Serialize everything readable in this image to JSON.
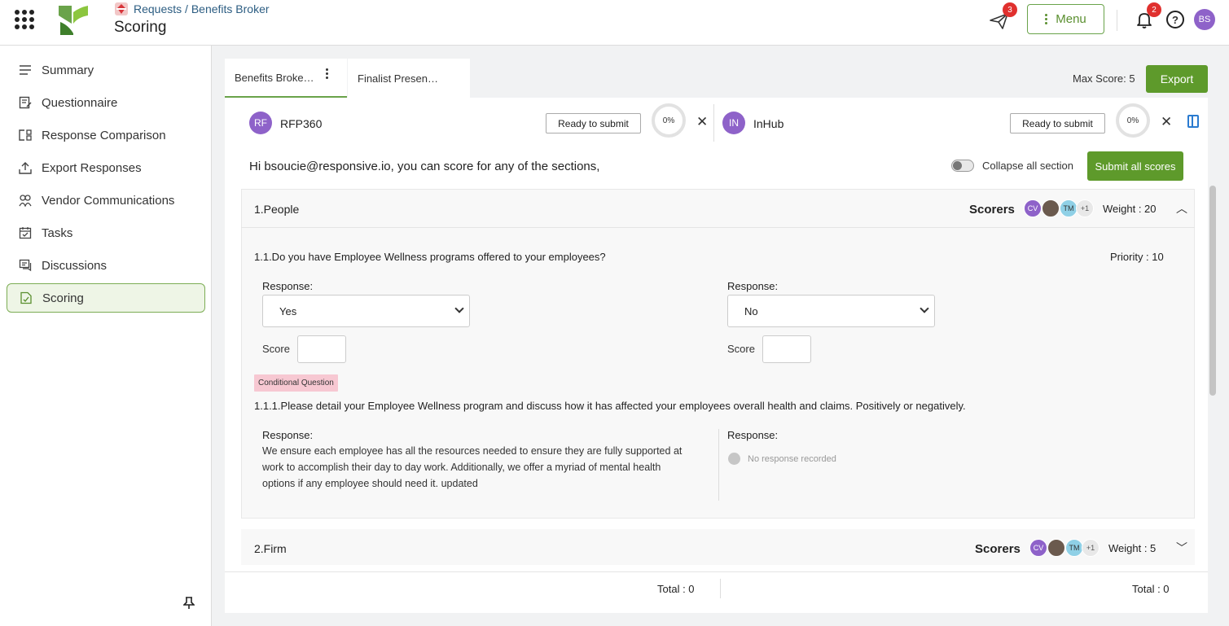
{
  "header": {
    "breadcrumb": "Requests / Benefits Broker",
    "title": "Scoring",
    "send_badge": "3",
    "menu_label": "Menu",
    "bell_badge": "2",
    "help_label": "?",
    "user_initials": "BS"
  },
  "sidebar": {
    "items": [
      {
        "label": "Summary",
        "icon": "list-icon"
      },
      {
        "label": "Questionnaire",
        "icon": "questionnaire-icon"
      },
      {
        "label": "Response Comparison",
        "icon": "compare-icon"
      },
      {
        "label": "Export Responses",
        "icon": "upload-icon"
      },
      {
        "label": "Vendor Communications",
        "icon": "users-icon"
      },
      {
        "label": "Tasks",
        "icon": "calendar-check-icon"
      },
      {
        "label": "Discussions",
        "icon": "chat-icon"
      },
      {
        "label": "Scoring",
        "icon": "scoring-icon",
        "active": true
      }
    ]
  },
  "tabs": [
    "Benefits Broke…",
    "Finalist Presen…"
  ],
  "toolbar": {
    "max_score": "Max Score: 5",
    "export_label": "Export"
  },
  "vendors": [
    {
      "initials": "RF",
      "name": "RFP360",
      "ready_label": "Ready to submit",
      "progress": "0%"
    },
    {
      "initials": "IN",
      "name": "InHub",
      "ready_label": "Ready to submit",
      "progress": "0%"
    }
  ],
  "greeting": "Hi bsoucie@responsive.io, you can score for any of the sections,",
  "collapse_label": "Collapse all section",
  "submit_all_label": "Submit all scores",
  "sections": [
    {
      "title": "1.People",
      "scorers_label": "Scorers",
      "scorers": [
        "CV",
        "",
        "TM",
        "+1"
      ],
      "weight": "Weight :  20",
      "question": "1.1.Do you have Employee Wellness programs offered to your employees?",
      "priority": "Priority :  10",
      "response_label": "Response:",
      "responses": [
        "Yes",
        "No"
      ],
      "score_label": "Score",
      "conditional_tag": "Conditional Question",
      "sub_question": "1.1.1.Please detail your Employee Wellness program and discuss how it has affected your employees overall health and claims. Positively or negatively.",
      "sub_response_left": "We ensure each employee has all the resources needed to ensure they are fully supported at work to accomplish their day to day work. Additionally, we offer a myriad of mental health options if any employee should need it. updated",
      "sub_response_right": "No response recorded"
    },
    {
      "title": "2.Firm",
      "scorers_label": "Scorers",
      "scorers": [
        "CV",
        "",
        "TM",
        "+1"
      ],
      "weight": "Weight :  5"
    }
  ],
  "totals": [
    "Total :   0",
    "Total :   0"
  ],
  "colors": {
    "brand_green": "#5e9a2b",
    "avatar_purple": "#8e62c9",
    "badge_red": "#e0302e",
    "conditional_pink": "#f7c8d2"
  }
}
